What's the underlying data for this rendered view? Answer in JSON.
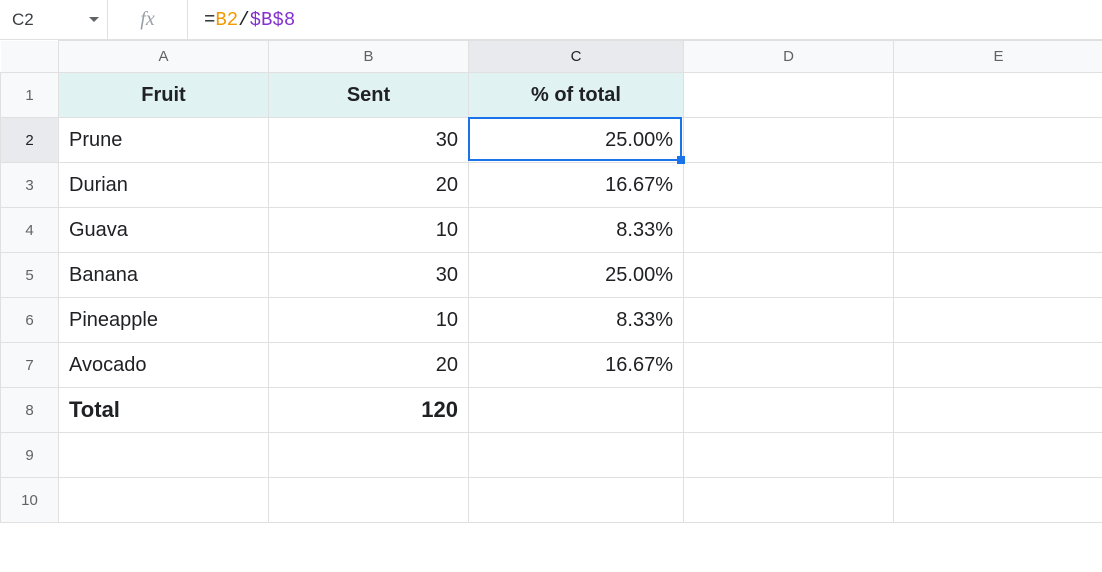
{
  "name_box": "C2",
  "fx_label": "fx",
  "formula": {
    "eq": "=",
    "ref1": "B2",
    "op": "/",
    "ref2": "$B$8"
  },
  "colHeaders": [
    "A",
    "B",
    "C",
    "D",
    "E"
  ],
  "rowHeaders": [
    "1",
    "2",
    "3",
    "4",
    "5",
    "6",
    "7",
    "8",
    "9",
    "10"
  ],
  "headerRow": {
    "A": "Fruit",
    "B": "Sent",
    "C": "% of total"
  },
  "rows": [
    {
      "A": "Prune",
      "B": "30",
      "C": "25.00%"
    },
    {
      "A": "Durian",
      "B": "20",
      "C": "16.67%"
    },
    {
      "A": "Guava",
      "B": "10",
      "C": "8.33%"
    },
    {
      "A": "Banana",
      "B": "30",
      "C": "25.00%"
    },
    {
      "A": "Pineapple",
      "B": "10",
      "C": "8.33%"
    },
    {
      "A": "Avocado",
      "B": "20",
      "C": "16.67%"
    }
  ],
  "totalRow": {
    "A": "Total",
    "B": "120",
    "C": ""
  },
  "selectedCell": "C2",
  "colors": {
    "headerFill": "#e0f2f1",
    "selectionBorder": "#1a73e8",
    "formulaRef1": "#f29900",
    "formulaRef2": "#8430ce"
  },
  "chart_data": {
    "type": "table",
    "columns": [
      "Fruit",
      "Sent",
      "% of total"
    ],
    "rows": [
      [
        "Prune",
        30,
        25.0
      ],
      [
        "Durian",
        20,
        16.67
      ],
      [
        "Guava",
        10,
        8.33
      ],
      [
        "Banana",
        30,
        25.0
      ],
      [
        "Pineapple",
        10,
        8.33
      ],
      [
        "Avocado",
        20,
        16.67
      ]
    ],
    "total": [
      "Total",
      120,
      null
    ]
  }
}
